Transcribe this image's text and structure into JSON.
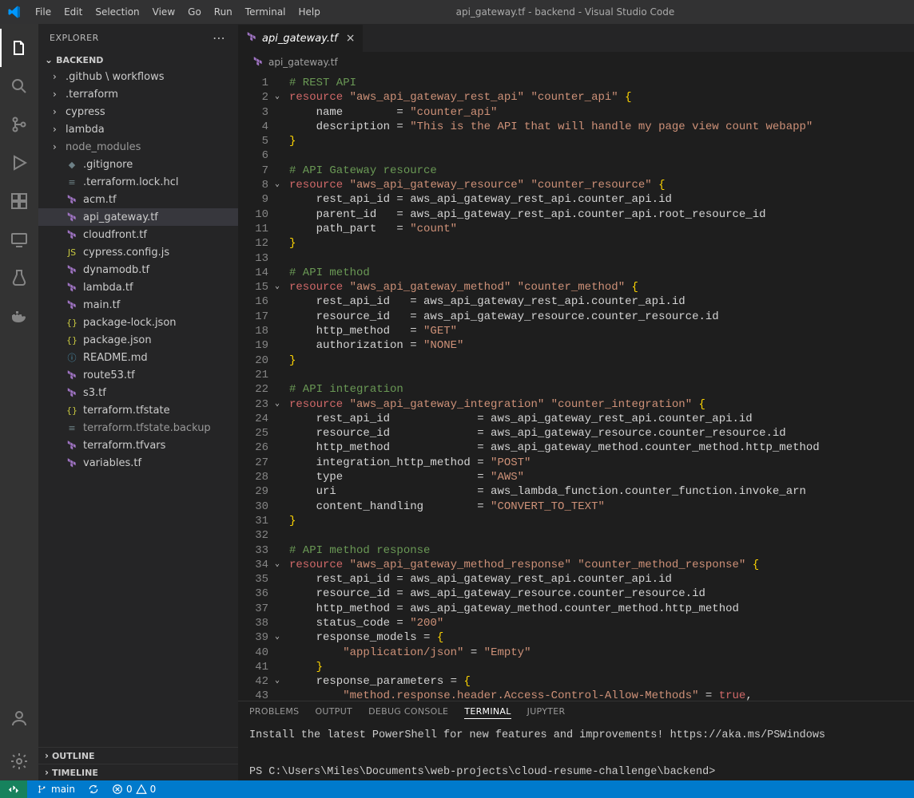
{
  "title": "api_gateway.tf - backend - Visual Studio Code",
  "menus": [
    "File",
    "Edit",
    "Selection",
    "View",
    "Go",
    "Run",
    "Terminal",
    "Help"
  ],
  "explorer": {
    "title": "EXPLORER",
    "root": "BACKEND",
    "tree": [
      {
        "kind": "folder",
        "name": ".github \\ workflows",
        "chev": "›",
        "depth": 0
      },
      {
        "kind": "folder",
        "name": ".terraform",
        "chev": "›",
        "depth": 0
      },
      {
        "kind": "folder",
        "name": "cypress",
        "chev": "›",
        "depth": 0
      },
      {
        "kind": "folder",
        "name": "lambda",
        "chev": "›",
        "depth": 0
      },
      {
        "kind": "folder",
        "name": "node_modules",
        "chev": "›",
        "depth": 0,
        "dim": true
      },
      {
        "kind": "file",
        "name": ".gitignore",
        "icon": "git",
        "depth": 0
      },
      {
        "kind": "file",
        "name": ".terraform.lock.hcl",
        "icon": "lock",
        "depth": 0
      },
      {
        "kind": "file",
        "name": "acm.tf",
        "icon": "tf",
        "depth": 0
      },
      {
        "kind": "file",
        "name": "api_gateway.tf",
        "icon": "tf",
        "depth": 0,
        "selected": true
      },
      {
        "kind": "file",
        "name": "cloudfront.tf",
        "icon": "tf",
        "depth": 0
      },
      {
        "kind": "file",
        "name": "cypress.config.js",
        "icon": "js",
        "depth": 0
      },
      {
        "kind": "file",
        "name": "dynamodb.tf",
        "icon": "tf",
        "depth": 0
      },
      {
        "kind": "file",
        "name": "lambda.tf",
        "icon": "tf",
        "depth": 0
      },
      {
        "kind": "file",
        "name": "main.tf",
        "icon": "tf",
        "depth": 0
      },
      {
        "kind": "file",
        "name": "package-lock.json",
        "icon": "json",
        "depth": 0
      },
      {
        "kind": "file",
        "name": "package.json",
        "icon": "json",
        "depth": 0
      },
      {
        "kind": "file",
        "name": "README.md",
        "icon": "info",
        "depth": 0
      },
      {
        "kind": "file",
        "name": "route53.tf",
        "icon": "tf",
        "depth": 0
      },
      {
        "kind": "file",
        "name": "s3.tf",
        "icon": "tf",
        "depth": 0
      },
      {
        "kind": "file",
        "name": "terraform.tfstate",
        "icon": "json",
        "depth": 0
      },
      {
        "kind": "file",
        "name": "terraform.tfstate.backup",
        "icon": "file",
        "depth": 0,
        "dim": true
      },
      {
        "kind": "file",
        "name": "terraform.tfvars",
        "icon": "tf",
        "depth": 0
      },
      {
        "kind": "file",
        "name": "variables.tf",
        "icon": "tf",
        "depth": 0
      }
    ],
    "outline": "OUTLINE",
    "timeline": "TIMELINE"
  },
  "tab": {
    "icon": "tf",
    "label": "api_gateway.tf"
  },
  "breadcrumb": {
    "icon": "tf",
    "label": "api_gateway.tf"
  },
  "code_lines": [
    {
      "n": 1,
      "seg": [
        [
          "cmt",
          "# REST API"
        ]
      ]
    },
    {
      "n": 2,
      "fold": true,
      "seg": [
        [
          "kw",
          "resource"
        ],
        [
          "id",
          " "
        ],
        [
          "str",
          "\"aws_api_gateway_rest_api\""
        ],
        [
          "id",
          " "
        ],
        [
          "str",
          "\"counter_api\""
        ],
        [
          "id",
          " "
        ],
        [
          "brc",
          "{"
        ]
      ]
    },
    {
      "n": 3,
      "seg": [
        [
          "id",
          "    name        = "
        ],
        [
          "str",
          "\"counter_api\""
        ]
      ]
    },
    {
      "n": 4,
      "seg": [
        [
          "id",
          "    description = "
        ],
        [
          "str",
          "\"This is the API that will handle my page view count webapp\""
        ]
      ]
    },
    {
      "n": 5,
      "seg": [
        [
          "brc",
          "}"
        ]
      ]
    },
    {
      "n": 6,
      "seg": [
        [
          "id",
          ""
        ]
      ]
    },
    {
      "n": 7,
      "seg": [
        [
          "cmt",
          "# API Gateway resource"
        ]
      ]
    },
    {
      "n": 8,
      "fold": true,
      "seg": [
        [
          "kw",
          "resource"
        ],
        [
          "id",
          " "
        ],
        [
          "str",
          "\"aws_api_gateway_resource\""
        ],
        [
          "id",
          " "
        ],
        [
          "str",
          "\"counter_resource\""
        ],
        [
          "id",
          " "
        ],
        [
          "brc",
          "{"
        ]
      ]
    },
    {
      "n": 9,
      "seg": [
        [
          "id",
          "    rest_api_id = aws_api_gateway_rest_api.counter_api.id"
        ]
      ]
    },
    {
      "n": 10,
      "seg": [
        [
          "id",
          "    parent_id   = aws_api_gateway_rest_api.counter_api.root_resource_id"
        ]
      ]
    },
    {
      "n": 11,
      "seg": [
        [
          "id",
          "    path_part   = "
        ],
        [
          "str",
          "\"count\""
        ]
      ]
    },
    {
      "n": 12,
      "seg": [
        [
          "brc",
          "}"
        ]
      ]
    },
    {
      "n": 13,
      "seg": [
        [
          "id",
          ""
        ]
      ]
    },
    {
      "n": 14,
      "seg": [
        [
          "cmt",
          "# API method"
        ]
      ]
    },
    {
      "n": 15,
      "fold": true,
      "seg": [
        [
          "kw",
          "resource"
        ],
        [
          "id",
          " "
        ],
        [
          "str",
          "\"aws_api_gateway_method\""
        ],
        [
          "id",
          " "
        ],
        [
          "str",
          "\"counter_method\""
        ],
        [
          "id",
          " "
        ],
        [
          "brc",
          "{"
        ]
      ]
    },
    {
      "n": 16,
      "seg": [
        [
          "id",
          "    rest_api_id   = aws_api_gateway_rest_api.counter_api.id"
        ]
      ]
    },
    {
      "n": 17,
      "seg": [
        [
          "id",
          "    resource_id   = aws_api_gateway_resource.counter_resource.id"
        ]
      ]
    },
    {
      "n": 18,
      "seg": [
        [
          "id",
          "    http_method   = "
        ],
        [
          "str",
          "\"GET\""
        ]
      ]
    },
    {
      "n": 19,
      "seg": [
        [
          "id",
          "    authorization = "
        ],
        [
          "str",
          "\"NONE\""
        ]
      ]
    },
    {
      "n": 20,
      "seg": [
        [
          "brc",
          "}"
        ]
      ]
    },
    {
      "n": 21,
      "seg": [
        [
          "id",
          ""
        ]
      ]
    },
    {
      "n": 22,
      "seg": [
        [
          "cmt",
          "# API integration"
        ]
      ]
    },
    {
      "n": 23,
      "fold": true,
      "seg": [
        [
          "kw",
          "resource"
        ],
        [
          "id",
          " "
        ],
        [
          "str",
          "\"aws_api_gateway_integration\""
        ],
        [
          "id",
          " "
        ],
        [
          "str",
          "\"counter_integration\""
        ],
        [
          "id",
          " "
        ],
        [
          "brc",
          "{"
        ]
      ]
    },
    {
      "n": 24,
      "seg": [
        [
          "id",
          "    rest_api_id             = aws_api_gateway_rest_api.counter_api.id"
        ]
      ]
    },
    {
      "n": 25,
      "seg": [
        [
          "id",
          "    resource_id             = aws_api_gateway_resource.counter_resource.id"
        ]
      ]
    },
    {
      "n": 26,
      "seg": [
        [
          "id",
          "    http_method             = aws_api_gateway_method.counter_method.http_method"
        ]
      ]
    },
    {
      "n": 27,
      "seg": [
        [
          "id",
          "    integration_http_method = "
        ],
        [
          "str",
          "\"POST\""
        ]
      ]
    },
    {
      "n": 28,
      "seg": [
        [
          "id",
          "    type                    = "
        ],
        [
          "str",
          "\"AWS\""
        ]
      ]
    },
    {
      "n": 29,
      "seg": [
        [
          "id",
          "    uri                     = aws_lambda_function.counter_function.invoke_arn"
        ]
      ]
    },
    {
      "n": 30,
      "seg": [
        [
          "id",
          "    content_handling        = "
        ],
        [
          "str",
          "\"CONVERT_TO_TEXT\""
        ]
      ]
    },
    {
      "n": 31,
      "seg": [
        [
          "brc",
          "}"
        ]
      ]
    },
    {
      "n": 32,
      "seg": [
        [
          "id",
          ""
        ]
      ]
    },
    {
      "n": 33,
      "seg": [
        [
          "cmt",
          "# API method response"
        ]
      ]
    },
    {
      "n": 34,
      "fold": true,
      "seg": [
        [
          "kw",
          "resource"
        ],
        [
          "id",
          " "
        ],
        [
          "str",
          "\"aws_api_gateway_method_response\""
        ],
        [
          "id",
          " "
        ],
        [
          "str",
          "\"counter_method_response\""
        ],
        [
          "id",
          " "
        ],
        [
          "brc",
          "{"
        ]
      ]
    },
    {
      "n": 35,
      "seg": [
        [
          "id",
          "    rest_api_id = aws_api_gateway_rest_api.counter_api.id"
        ]
      ]
    },
    {
      "n": 36,
      "seg": [
        [
          "id",
          "    resource_id = aws_api_gateway_resource.counter_resource.id"
        ]
      ]
    },
    {
      "n": 37,
      "seg": [
        [
          "id",
          "    http_method = aws_api_gateway_method.counter_method.http_method"
        ]
      ]
    },
    {
      "n": 38,
      "seg": [
        [
          "id",
          "    status_code = "
        ],
        [
          "str",
          "\"200\""
        ]
      ]
    },
    {
      "n": 39,
      "fold": true,
      "seg": [
        [
          "id",
          "    response_models = "
        ],
        [
          "brc",
          "{"
        ]
      ]
    },
    {
      "n": 40,
      "seg": [
        [
          "id",
          "        "
        ],
        [
          "str",
          "\"application/json\""
        ],
        [
          "id",
          " = "
        ],
        [
          "str",
          "\"Empty\""
        ]
      ]
    },
    {
      "n": 41,
      "seg": [
        [
          "id",
          "    "
        ],
        [
          "brc",
          "}"
        ]
      ]
    },
    {
      "n": 42,
      "fold": true,
      "seg": [
        [
          "id",
          "    response_parameters = "
        ],
        [
          "brc",
          "{"
        ]
      ]
    },
    {
      "n": 43,
      "seg": [
        [
          "id",
          "        "
        ],
        [
          "str",
          "\"method.response.header.Access-Control-Allow-Methods\""
        ],
        [
          "id",
          " = "
        ],
        [
          "kw",
          "true"
        ],
        [
          "id",
          ","
        ]
      ]
    }
  ],
  "panel": {
    "tabs": [
      "PROBLEMS",
      "OUTPUT",
      "DEBUG CONSOLE",
      "TERMINAL",
      "JUPYTER"
    ],
    "active_tab": "TERMINAL",
    "terminal_lines": [
      "Install the latest PowerShell for new features and improvements! https://aka.ms/PSWindows",
      "",
      "PS C:\\Users\\Miles\\Documents\\web-projects\\cloud-resume-challenge\\backend>"
    ]
  },
  "status": {
    "branch": "main",
    "errors": "0",
    "warnings": "0"
  }
}
